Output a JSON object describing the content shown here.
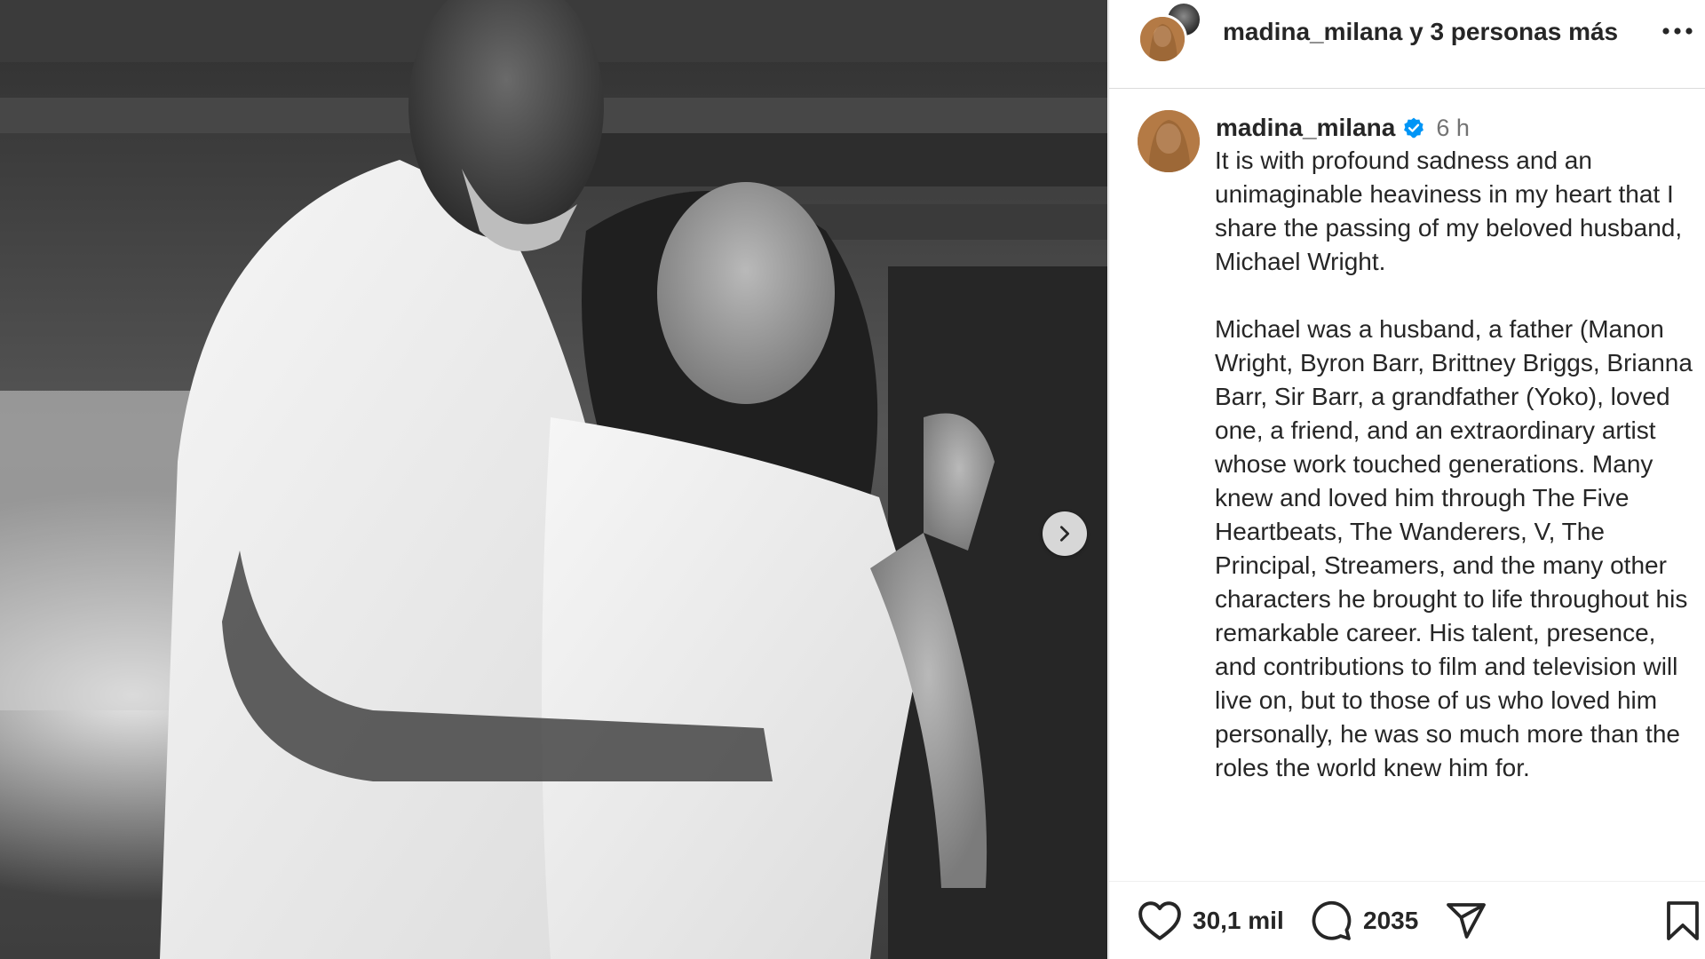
{
  "header": {
    "username": "madina_milana",
    "others_text": "y 3 personas más",
    "more_icon": "more-horizontal-icon"
  },
  "caption": {
    "username": "madina_milana",
    "verified_icon": "verified-badge-icon",
    "time": "6 h",
    "text": "It is with profound sadness and an unimaginable heaviness in my heart that I share the passing of my beloved husband, Michael Wright.\n\nMichael was a husband, a father (Manon Wright, Byron Barr, Brittney Briggs, Brianna Barr, Sir Barr, a grandfather (Yoko), loved one, a friend, and an extraordinary artist whose work touched generations. Many knew and loved him through The Five Heartbeats, The Wanderers, V, The Principal, Streamers, and the many other characters he brought to life throughout his remarkable career. His talent, presence, and contributions to film and television will live on, but to those of us who loved him personally, he was so much more than the roles the world knew him for."
  },
  "actions": {
    "likes": "30,1 mil",
    "comments": "2035",
    "like_icon": "heart-icon",
    "comment_icon": "comment-icon",
    "share_icon": "share-icon",
    "save_icon": "bookmark-icon"
  },
  "carousel": {
    "next_icon": "chevron-right-icon"
  },
  "colors": {
    "text": "#262626",
    "muted": "#737373",
    "verified": "#0095f6",
    "divider": "#dbdbdb"
  }
}
